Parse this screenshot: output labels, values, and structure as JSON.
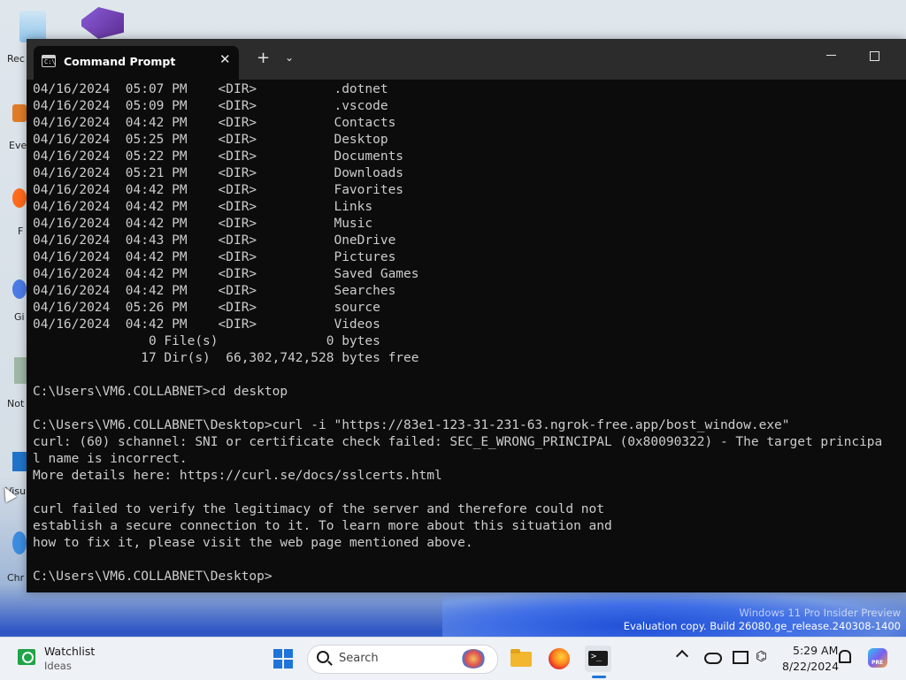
{
  "desktop": {
    "icons": [
      {
        "label": "Rec"
      },
      {
        "label": "Eve"
      },
      {
        "label": "F"
      },
      {
        "label": "Gi"
      },
      {
        "label": "Not"
      },
      {
        "label": "Visu"
      },
      {
        "label": "Chr"
      }
    ],
    "watermark_line1": "Windows 11 Pro Insider Preview",
    "watermark_line2": "Evaluation copy. Build 26080.ge_release.240308-1400"
  },
  "terminal": {
    "tab_title": "Command Prompt",
    "tab_icon_text": "C:\\",
    "lines": [
      "04/16/2024  05:07 PM    <DIR>          .dotnet",
      "04/16/2024  05:09 PM    <DIR>          .vscode",
      "04/16/2024  04:42 PM    <DIR>          Contacts",
      "04/16/2024  05:25 PM    <DIR>          Desktop",
      "04/16/2024  05:22 PM    <DIR>          Documents",
      "04/16/2024  05:21 PM    <DIR>          Downloads",
      "04/16/2024  04:42 PM    <DIR>          Favorites",
      "04/16/2024  04:42 PM    <DIR>          Links",
      "04/16/2024  04:42 PM    <DIR>          Music",
      "04/16/2024  04:43 PM    <DIR>          OneDrive",
      "04/16/2024  04:42 PM    <DIR>          Pictures",
      "04/16/2024  04:42 PM    <DIR>          Saved Games",
      "04/16/2024  04:42 PM    <DIR>          Searches",
      "04/16/2024  05:26 PM    <DIR>          source",
      "04/16/2024  04:42 PM    <DIR>          Videos",
      "               0 File(s)              0 bytes",
      "              17 Dir(s)  66,302,742,528 bytes free",
      "",
      "C:\\Users\\VM6.COLLABNET>cd desktop",
      "",
      "C:\\Users\\VM6.COLLABNET\\Desktop>curl -i \"https://83e1-123-31-231-63.ngrok-free.app/bost_window.exe\"",
      "curl: (60) schannel: SNI or certificate check failed: SEC_E_WRONG_PRINCIPAL (0x80090322) - The target principa",
      "l name is incorrect.",
      "More details here: https://curl.se/docs/sslcerts.html",
      "",
      "curl failed to verify the legitimacy of the server and therefore could not",
      "establish a secure connection to it. To learn more about this situation and",
      "how to fix it, please visit the web page mentioned above.",
      "",
      "C:\\Users\\VM6.COLLABNET\\Desktop>"
    ]
  },
  "taskbar": {
    "widget_title": "Watchlist",
    "widget_subtitle": "Ideas",
    "search_placeholder": "Search",
    "terminal_icon_text": ">_",
    "copilot_badge": "PRE",
    "clock_time": "5:29 AM",
    "clock_date": "8/22/2024"
  },
  "colors": {
    "console_bg": "#0c0c0c",
    "console_text": "#cccccc",
    "titlebar_bg": "#2c2c2c",
    "taskbar_bg": "#eef1f6",
    "accent": "#1e74d8"
  }
}
